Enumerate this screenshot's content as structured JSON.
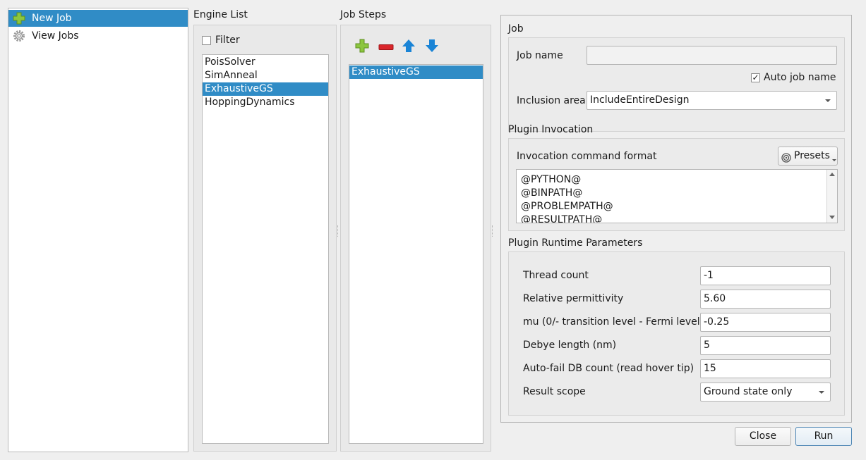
{
  "nav": {
    "items": [
      {
        "label": "New Job",
        "icon": "plus-icon",
        "selected": true
      },
      {
        "label": "View Jobs",
        "icon": "gear-icon",
        "selected": false
      }
    ]
  },
  "engine_list": {
    "title": "Engine List",
    "filter_label": "Filter",
    "filter_checked": false,
    "items": [
      "PoisSolver",
      "SimAnneal",
      "ExhaustiveGS",
      "HoppingDynamics"
    ],
    "selected": "ExhaustiveGS"
  },
  "job_steps": {
    "title": "Job Steps",
    "items": [
      "ExhaustiveGS"
    ],
    "selected": "ExhaustiveGS"
  },
  "job": {
    "title": "Job",
    "job_name_label": "Job name",
    "job_name_value": "",
    "auto_job_name_label": "Auto job name",
    "auto_job_name_checked": true,
    "inclusion_area_label": "Inclusion area",
    "inclusion_area_value": "IncludeEntireDesign"
  },
  "plugin_invocation": {
    "title": "Plugin Invocation",
    "command_format_label": "Invocation command format",
    "presets_label": "Presets",
    "command_lines": [
      "@PYTHON@",
      "@BINPATH@",
      "@PROBLEMPATH@",
      "@RESULTPATH@"
    ]
  },
  "runtime_params": {
    "title": "Plugin Runtime Parameters",
    "params": [
      {
        "label": "Thread count",
        "value": "-1"
      },
      {
        "label": "Relative permittivity",
        "value": "5.60"
      },
      {
        "label": "mu (0/- transition level - Fermi level)",
        "value": "-0.25"
      },
      {
        "label": "Debye length (nm)",
        "value": "5"
      },
      {
        "label": "Auto-fail DB count (read hover tip)",
        "value": "15"
      }
    ],
    "result_scope_label": "Result scope",
    "result_scope_value": "Ground state only"
  },
  "buttons": {
    "close_label": "Close",
    "run_label": "Run"
  },
  "colors": {
    "selection": "#308cc6",
    "add_green": "#7ab317",
    "remove_red": "#d9262b",
    "arrow_blue": "#1a84d6"
  }
}
